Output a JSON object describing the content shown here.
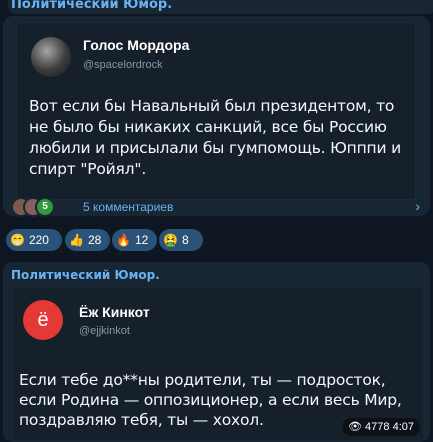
{
  "post1": {
    "channel_label": "Политический Юмор.",
    "tweet": {
      "author": "Голос Мордора",
      "handle": "@spacelordrock",
      "text": "Вот если бы Навальный был президентом, то не было бы никаких санкций, все бы Россию любили и присылали бы гумпомощь. Юпппи и спирт \"Ройял\"."
    },
    "comments": {
      "avatar3_label": "5",
      "label": "5 комментариев",
      "arrow_icon": "chevron-right-icon"
    },
    "reactions": [
      {
        "emoji": "😁",
        "count": "220"
      },
      {
        "emoji": "👍",
        "count": "28"
      },
      {
        "emoji": "🔥",
        "count": "12"
      },
      {
        "emoji": "🤮",
        "count": "8"
      }
    ]
  },
  "post2": {
    "channel_label": "Политический Юмор.",
    "tweet": {
      "author": "Ёж Кинкот",
      "handle": "@ejjkinkot",
      "avatar_glyph": "ё",
      "text": "Если тебе до**ны родители, ты — подросток, если Родина — оппозиционер, а если весь Мир, поздравляю тебя, ты — хохол."
    },
    "views": "4778",
    "time": "4:07"
  },
  "colors": {
    "background": "#0e1621",
    "bubble": "#182533",
    "accent": "#6ab3f3",
    "reaction_bg": "#2b5278"
  }
}
